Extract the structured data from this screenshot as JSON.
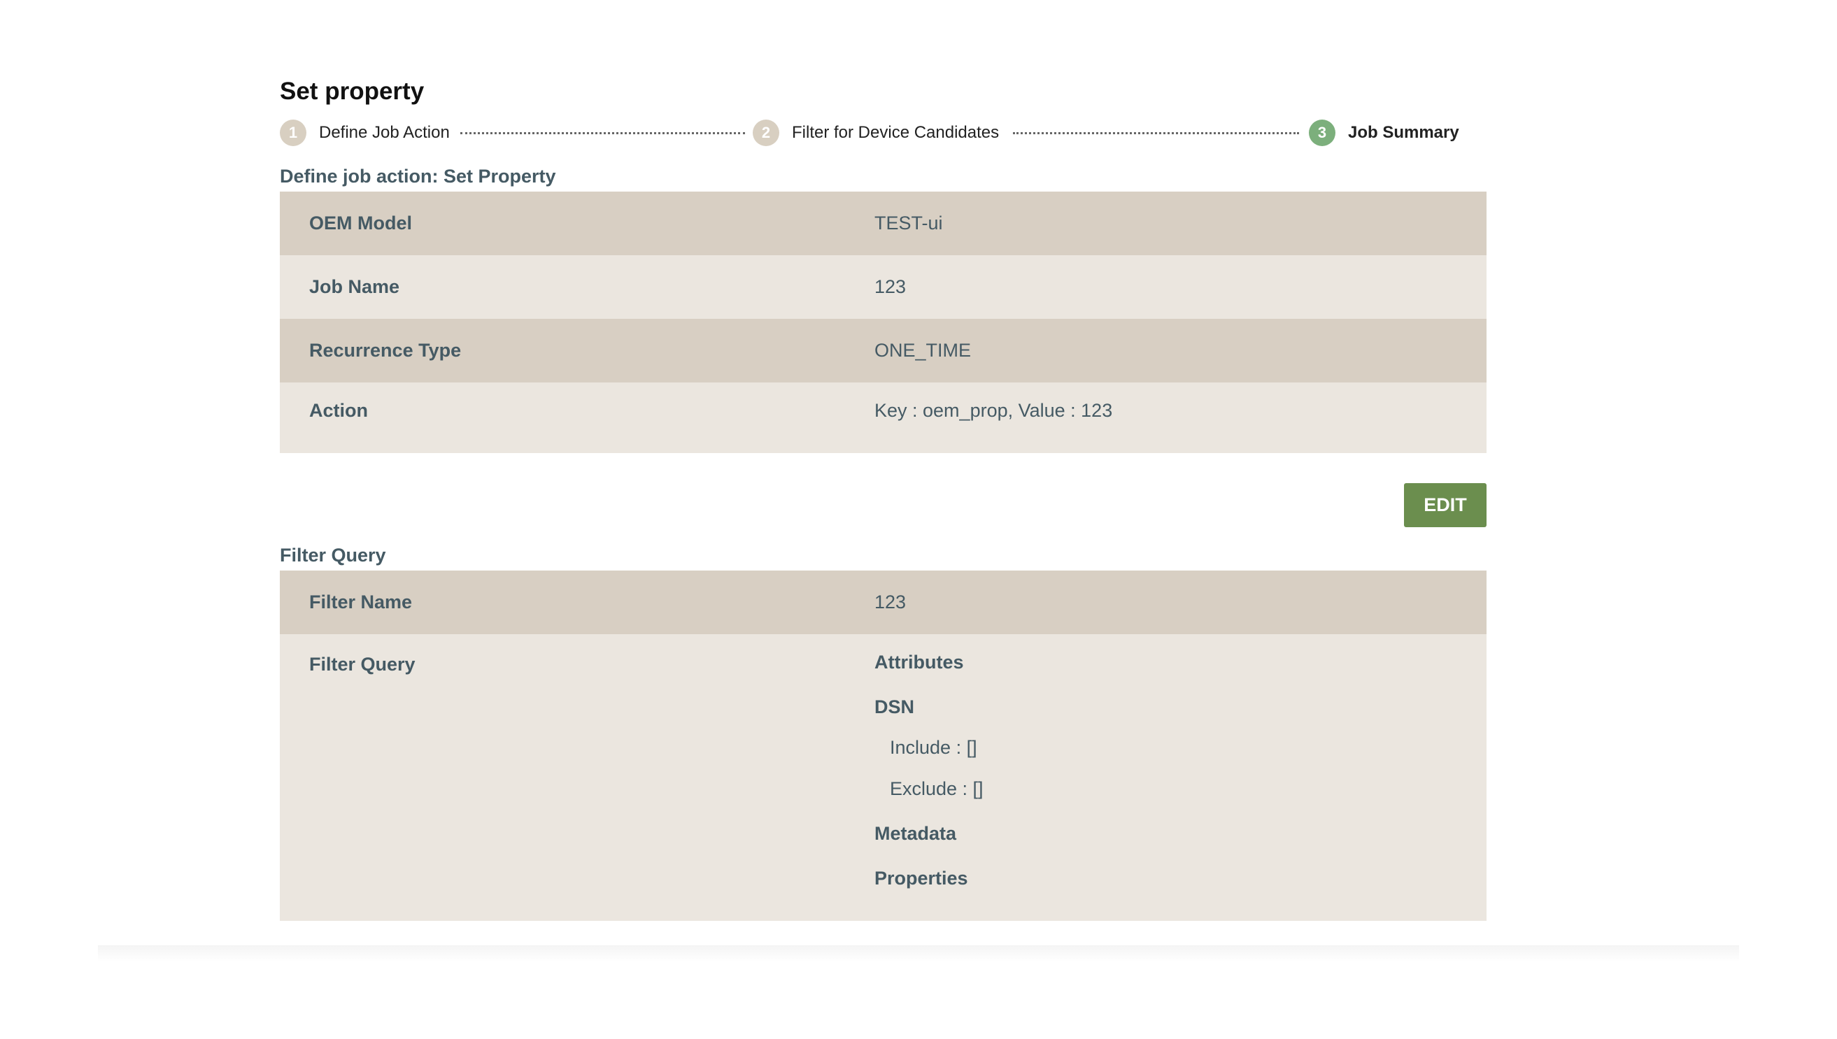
{
  "page": {
    "title": "Set property"
  },
  "stepper": {
    "steps": [
      {
        "number": "1",
        "label": "Define Job Action",
        "active": false
      },
      {
        "number": "2",
        "label": "Filter for Device Candidates",
        "active": false
      },
      {
        "number": "3",
        "label": "Job Summary",
        "active": true
      }
    ]
  },
  "job_action": {
    "section_title": "Define job action: Set Property",
    "rows": [
      {
        "key": "OEM Model",
        "value": "TEST-ui"
      },
      {
        "key": "Job Name",
        "value": "123"
      },
      {
        "key": "Recurrence Type",
        "value": "ONE_TIME"
      },
      {
        "key": "Action",
        "value": "Key : oem_prop, Value : 123"
      }
    ],
    "edit_label": "EDIT"
  },
  "filter_query": {
    "section_title": "Filter Query",
    "filter_name_key": "Filter Name",
    "filter_name_value": "123",
    "filter_query_key": "Filter Query",
    "attributes_label": "Attributes",
    "dsn_label": "DSN",
    "include_text": "Include : []",
    "exclude_text": "Exclude : []",
    "metadata_label": "Metadata",
    "properties_label": "Properties"
  },
  "colors": {
    "row_dark": "#d8cfc3",
    "row_light": "#ebe6df",
    "accent_green": "#6b8e4e",
    "step_active": "#7caf7c",
    "step_inactive": "#d8cfc1"
  }
}
